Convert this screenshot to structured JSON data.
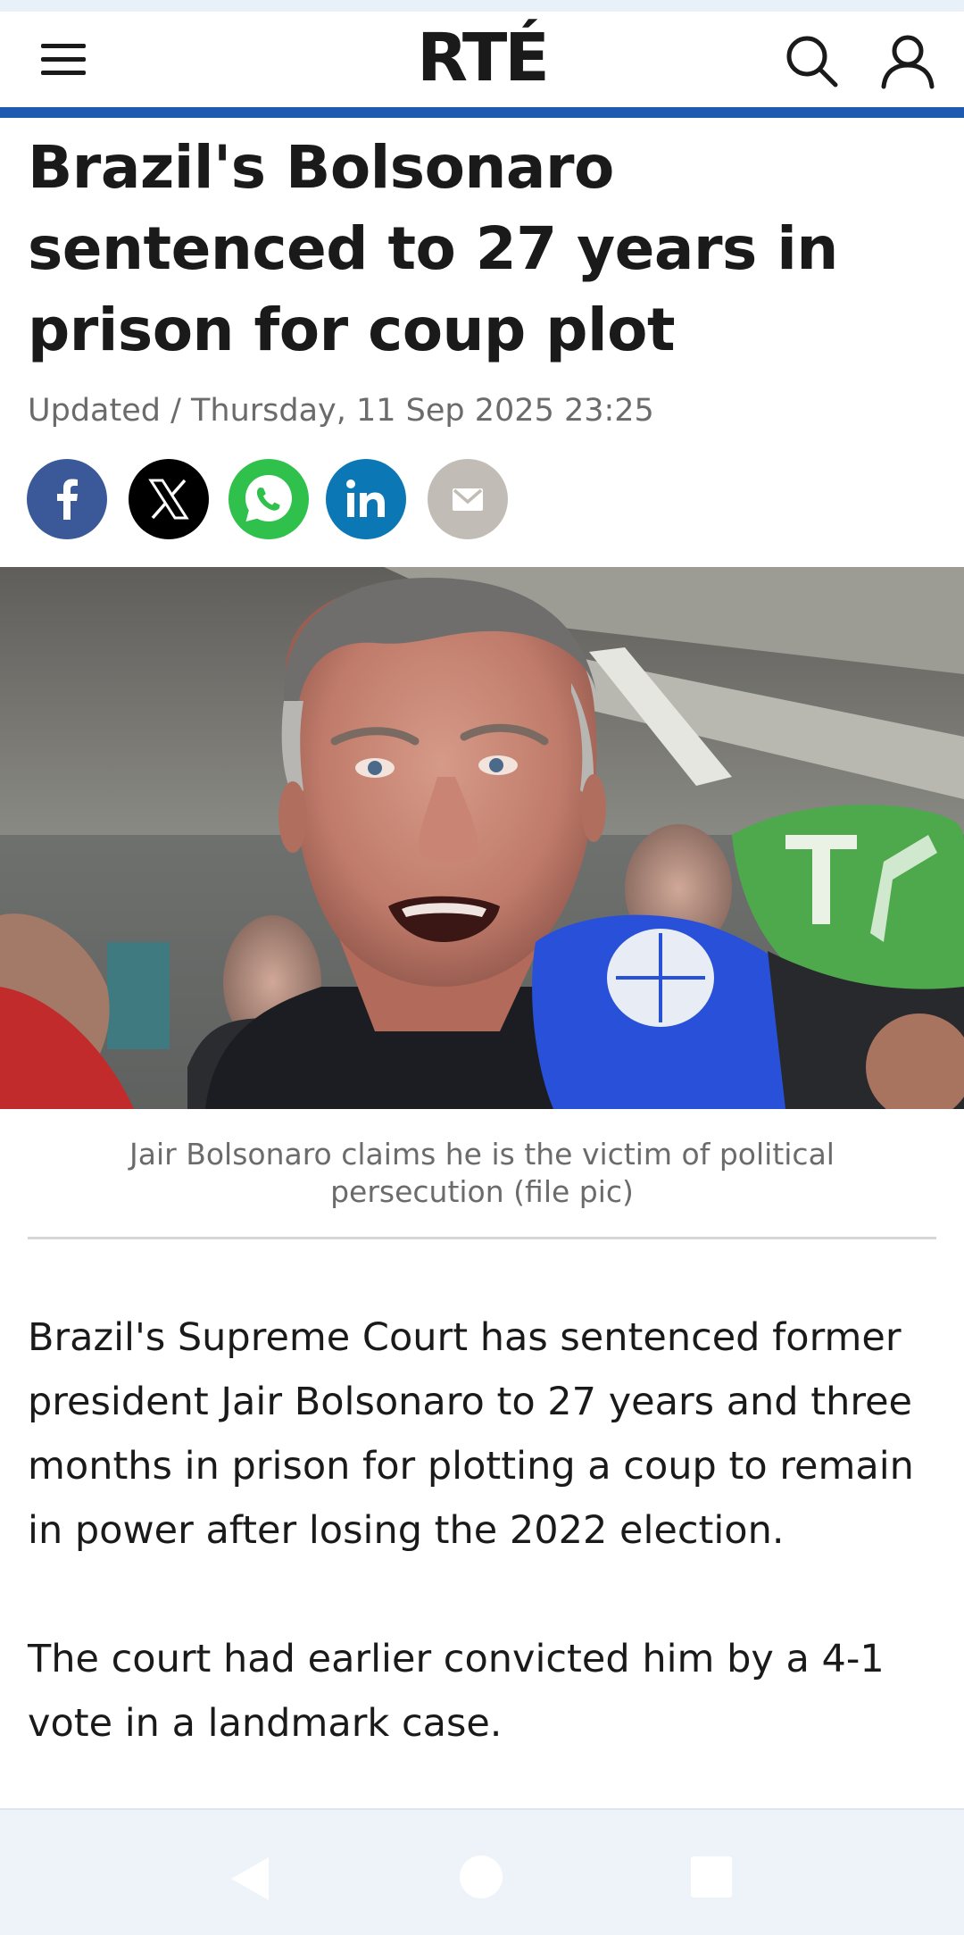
{
  "header": {
    "logo": "RTÉ",
    "menu_icon": "hamburger-menu-icon",
    "search_icon": "search-icon",
    "account_icon": "user-account-icon",
    "rule_color": "#1f5ab1"
  },
  "article": {
    "headline": "Brazil's Bolsonaro sentenced to 27 years in prison for coup plot",
    "updated": "Updated / Thursday, 11 Sep 2025 23:25",
    "share": [
      {
        "network": "facebook",
        "icon": "facebook-icon",
        "color": "#3b5998"
      },
      {
        "network": "x",
        "icon": "x-icon",
        "color": "#000000"
      },
      {
        "network": "whatsapp",
        "icon": "whatsapp-icon",
        "color": "#2fc14b"
      },
      {
        "network": "linkedin",
        "icon": "linkedin-icon",
        "color": "#0b77b5"
      },
      {
        "network": "email",
        "icon": "email-icon",
        "color": "#c1bdb6"
      }
    ],
    "image_caption": "Jair Bolsonaro claims he is the victim of political persecution (file pic)",
    "paragraphs": [
      "Brazil's Supreme Court has sentenced former president Jair Bolsonaro to 27 years and three months in prison for plotting a coup to remain in power after losing the 2022 election.",
      "The court had earlier convicted him by a 4-1 vote in a landmark case."
    ]
  },
  "system_nav": {
    "back_icon": "back-triangle-icon",
    "home_icon": "home-circle-icon",
    "recents_icon": "recents-square-icon"
  }
}
